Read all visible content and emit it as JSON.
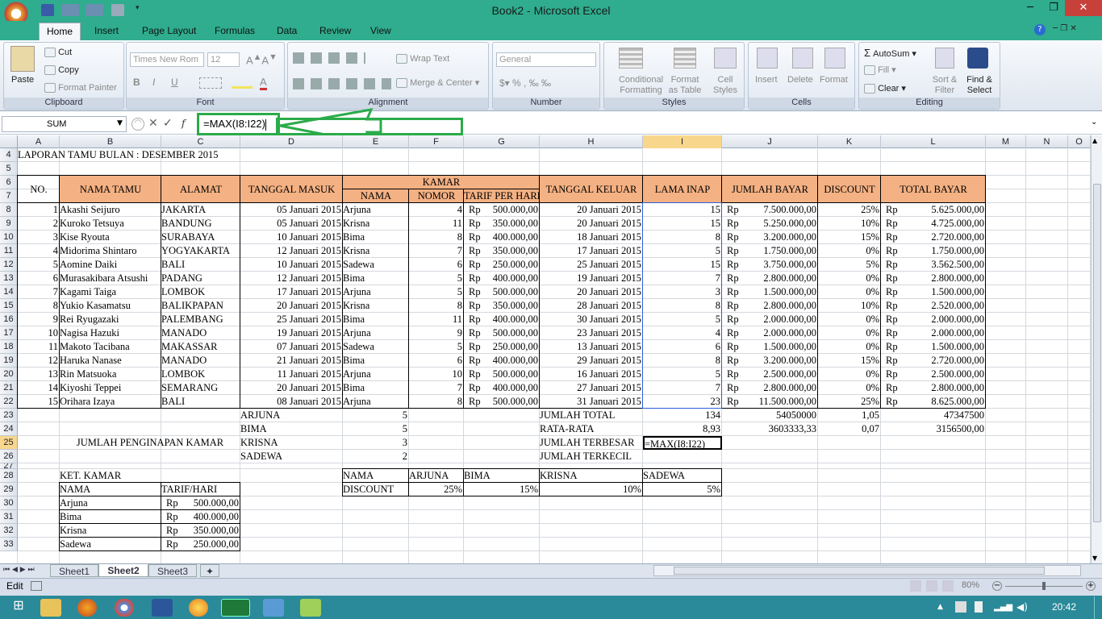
{
  "window": {
    "title": "Book2 - Microsoft Excel",
    "minimize": "─",
    "restore": "❐",
    "close": "✕"
  },
  "tabs": [
    "Home",
    "Insert",
    "Page Layout",
    "Formulas",
    "Data",
    "Review",
    "View"
  ],
  "ribbon": {
    "clipboard": {
      "label": "Clipboard",
      "paste": "Paste",
      "cut": "Cut",
      "copy": "Copy",
      "format_painter": "Format Painter"
    },
    "font": {
      "label": "Font",
      "font_name": "Times New Rom",
      "font_size": "12"
    },
    "alignment": {
      "label": "Alignment",
      "wrap_text": "Wrap Text",
      "merge_center": "Merge & Center"
    },
    "number": {
      "label": "Number",
      "format": "General"
    },
    "styles": {
      "label": "Styles",
      "conditional": "Conditional Formatting",
      "format_table": "Format as Table",
      "cell_styles": "Cell Styles"
    },
    "cells": {
      "label": "Cells",
      "insert": "Insert",
      "delete": "Delete",
      "format": "Format"
    },
    "editing": {
      "label": "Editing",
      "autosum": "AutoSum",
      "fill": "Fill",
      "clear": "Clear",
      "sort_filter": "Sort & Filter",
      "find_select": "Find & Select"
    }
  },
  "formula_bar": {
    "name_box": "SUM",
    "formula": "=MAX(I8:I22)"
  },
  "columns": [
    "A",
    "B",
    "C",
    "D",
    "E",
    "F",
    "G",
    "H",
    "I",
    "J",
    "K",
    "L",
    "M",
    "N",
    "O"
  ],
  "rows": [
    "4",
    "5",
    "6",
    "7",
    "8",
    "9",
    "10",
    "11",
    "12",
    "13",
    "14",
    "15",
    "16",
    "17",
    "18",
    "19",
    "20",
    "21",
    "22",
    "23",
    "24",
    "25",
    "26",
    "27",
    "28",
    "29",
    "30",
    "31",
    "32",
    "33"
  ],
  "sheet": {
    "title": "LAPORAN TAMU BULAN : DESEMBER 2015",
    "headers": {
      "no": "NO.",
      "nama_tamu": "NAMA TAMU",
      "alamat": "ALAMAT",
      "tgl_masuk": "TANGGAL MASUK",
      "kamar": "KAMAR",
      "nama": "NAMA",
      "nomor": "NOMOR",
      "tarif": "TARIF PER HARI",
      "tgl_keluar": "TANGGAL KELUAR",
      "lama": "LAMA INAP",
      "jumlah": "JUMLAH BAYAR",
      "discount": "DISCOUNT",
      "total": "TOTAL BAYAR"
    },
    "currency": "Rp",
    "rows": [
      [
        "1",
        "Akashi Seijuro",
        "JAKARTA",
        "05 Januari 2015",
        "Arjuna",
        "4",
        "500.000,00",
        "20 Januari 2015",
        "15",
        "7.500.000,00",
        "25%",
        "5.625.000,00"
      ],
      [
        "2",
        "Kuroko Tetsuya",
        "BANDUNG",
        "05 Januari 2015",
        "Krisna",
        "11",
        "350.000,00",
        "20 Januari 2015",
        "15",
        "5.250.000,00",
        "10%",
        "4.725.000,00"
      ],
      [
        "3",
        "Kise Ryouta",
        "SURABAYA",
        "10 Januari 2015",
        "Bima",
        "8",
        "400.000,00",
        "18 Januari 2015",
        "8",
        "3.200.000,00",
        "15%",
        "2.720.000,00"
      ],
      [
        "4",
        "Midorima Shintaro",
        "YOGYAKARTA",
        "12 Januari 2015",
        "Krisna",
        "7",
        "350.000,00",
        "17 Januari 2015",
        "5",
        "1.750.000,00",
        "0%",
        "1.750.000,00"
      ],
      [
        "5",
        "Aomine Daiki",
        "BALI",
        "10 Januari 2015",
        "Sadewa",
        "6",
        "250.000,00",
        "25 Januari 2015",
        "15",
        "3.750.000,00",
        "5%",
        "3.562.500,00"
      ],
      [
        "6",
        "Murasakibara Atsushi",
        "PADANG",
        "12 Januari 2015",
        "Bima",
        "5",
        "400.000,00",
        "19 Januari 2015",
        "7",
        "2.800.000,00",
        "0%",
        "2.800.000,00"
      ],
      [
        "7",
        "Kagami Taiga",
        "LOMBOK",
        "17 Januari 2015",
        "Arjuna",
        "5",
        "500.000,00",
        "20 Januari 2015",
        "3",
        "1.500.000,00",
        "0%",
        "1.500.000,00"
      ],
      [
        "8",
        "Yukio Kasamatsu",
        "BALIKPAPAN",
        "20 Januari 2015",
        "Krisna",
        "8",
        "350.000,00",
        "28 Januari 2015",
        "8",
        "2.800.000,00",
        "10%",
        "2.520.000,00"
      ],
      [
        "9",
        "Rei Ryugazaki",
        "PALEMBANG",
        "25 Januari 2015",
        "Bima",
        "11",
        "400.000,00",
        "30 Januari 2015",
        "5",
        "2.000.000,00",
        "0%",
        "2.000.000,00"
      ],
      [
        "10",
        "Nagisa Hazuki",
        "MANADO",
        "19 Januari 2015",
        "Arjuna",
        "9",
        "500.000,00",
        "23 Januari 2015",
        "4",
        "2.000.000,00",
        "0%",
        "2.000.000,00"
      ],
      [
        "11",
        "Makoto Tacibana",
        "MAKASSAR",
        "07 Januari 2015",
        "Sadewa",
        "5",
        "250.000,00",
        "13 Januari 2015",
        "6",
        "1.500.000,00",
        "0%",
        "1.500.000,00"
      ],
      [
        "12",
        "Haruka Nanase",
        "MANADO",
        "21 Januari 2015",
        "Bima",
        "6",
        "400.000,00",
        "29 Januari 2015",
        "8",
        "3.200.000,00",
        "15%",
        "2.720.000,00"
      ],
      [
        "13",
        "Rin Matsuoka",
        "LOMBOK",
        "11 Januari 2015",
        "Arjuna",
        "10",
        "500.000,00",
        "16 Januari 2015",
        "5",
        "2.500.000,00",
        "0%",
        "2.500.000,00"
      ],
      [
        "14",
        "Kiyoshi Teppei",
        "SEMARANG",
        "20 Januari 2015",
        "Bima",
        "7",
        "400.000,00",
        "27 Januari 2015",
        "7",
        "2.800.000,00",
        "0%",
        "2.800.000,00"
      ],
      [
        "15",
        "Orihara Izaya",
        "BALI",
        "08 Januari 2015",
        "Arjuna",
        "8",
        "500.000,00",
        "31 Januari 2015",
        "23",
        "11.500.000,00",
        "25%",
        "8.625.000,00"
      ]
    ],
    "summary_label": "JUMLAH PENGINAPAN KAMAR",
    "room_counts": [
      [
        "ARJUNA",
        "5"
      ],
      [
        "BIMA",
        "5"
      ],
      [
        "KRISNA",
        "3"
      ],
      [
        "SADEWA",
        "2"
      ]
    ],
    "totals": {
      "jumlah_total": "JUMLAH TOTAL",
      "rata_rata": "RATA-RATA",
      "terbesar": "JUMLAH TERBESAR",
      "terkecil": "JUMLAH TERKECIL",
      "total_lama": "134",
      "total_bayar": "54050000",
      "total_disc": "1,05",
      "total_total": "47347500",
      "avg_lama": "8,93",
      "avg_bayar": "3603333,33",
      "avg_disc": "0,07",
      "avg_total": "3156500,00",
      "editing": "=MAX(I8:I22)"
    },
    "ket": {
      "title": "KET. KAMAR",
      "nama": "NAMA",
      "tarif": "TARIF/HARI",
      "items": [
        [
          "Arjuna",
          "500.000,00"
        ],
        [
          "Bima",
          "400.000,00"
        ],
        [
          "Krisna",
          "350.000,00"
        ],
        [
          "Sadewa",
          "250.000,00"
        ]
      ]
    },
    "disc": {
      "nama": "NAMA",
      "discount": "DISCOUNT",
      "names": [
        "ARJUNA",
        "BIMA",
        "KRISNA",
        "SADEWA"
      ],
      "values": [
        "25%",
        "15%",
        "10%",
        "5%"
      ]
    }
  },
  "sheet_tabs": [
    "Sheet1",
    "Sheet2",
    "Sheet3"
  ],
  "status": {
    "mode": "Edit",
    "zoom": "80%"
  },
  "taskbar": {
    "time": "20:42"
  }
}
